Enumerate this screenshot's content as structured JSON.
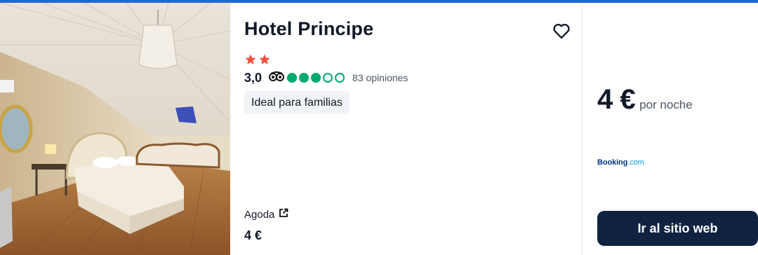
{
  "hotel": {
    "name": "Hotel Principe",
    "stars": 2,
    "rating": "3,0",
    "bubbles_filled": 3,
    "bubbles_total": 5,
    "reviews_text": "83 opiniones",
    "tag": "Ideal para familias"
  },
  "offer": {
    "provider": "Agoda",
    "price": "4 €"
  },
  "best_deal": {
    "price": "4 €",
    "per_night": "por noche",
    "provider_logo_main": "Booking",
    "provider_logo_suffix": ".com",
    "cta_label": "Ir al sitio web"
  },
  "icons": {
    "favorite": "heart-outline-icon",
    "stars": "star-icon",
    "rating_source": "tripadvisor-owl-icon",
    "external": "external-link-icon"
  },
  "colors": {
    "accent_top": "#1d68d6",
    "star": "#f0513a",
    "bubble": "#00aa6c",
    "cta_bg": "#0f2340",
    "booking_blue": "#003580",
    "booking_light": "#009fe3"
  }
}
